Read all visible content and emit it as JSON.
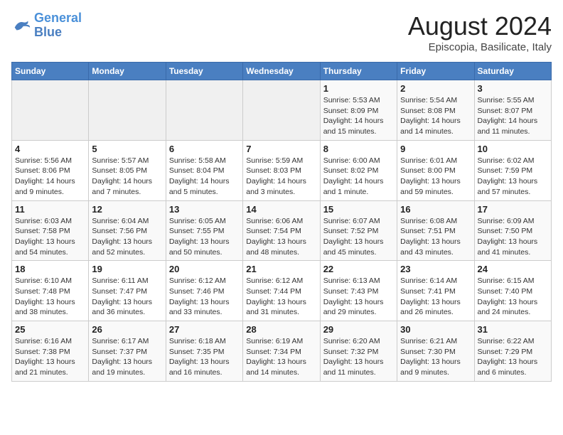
{
  "header": {
    "logo_general": "General",
    "logo_blue": "Blue",
    "month_title": "August 2024",
    "location": "Episcopia, Basilicate, Italy"
  },
  "days_of_week": [
    "Sunday",
    "Monday",
    "Tuesday",
    "Wednesday",
    "Thursday",
    "Friday",
    "Saturday"
  ],
  "weeks": [
    [
      {
        "num": "",
        "info": ""
      },
      {
        "num": "",
        "info": ""
      },
      {
        "num": "",
        "info": ""
      },
      {
        "num": "",
        "info": ""
      },
      {
        "num": "1",
        "info": "Sunrise: 5:53 AM\nSunset: 8:09 PM\nDaylight: 14 hours\nand 15 minutes."
      },
      {
        "num": "2",
        "info": "Sunrise: 5:54 AM\nSunset: 8:08 PM\nDaylight: 14 hours\nand 14 minutes."
      },
      {
        "num": "3",
        "info": "Sunrise: 5:55 AM\nSunset: 8:07 PM\nDaylight: 14 hours\nand 11 minutes."
      }
    ],
    [
      {
        "num": "4",
        "info": "Sunrise: 5:56 AM\nSunset: 8:06 PM\nDaylight: 14 hours\nand 9 minutes."
      },
      {
        "num": "5",
        "info": "Sunrise: 5:57 AM\nSunset: 8:05 PM\nDaylight: 14 hours\nand 7 minutes."
      },
      {
        "num": "6",
        "info": "Sunrise: 5:58 AM\nSunset: 8:04 PM\nDaylight: 14 hours\nand 5 minutes."
      },
      {
        "num": "7",
        "info": "Sunrise: 5:59 AM\nSunset: 8:03 PM\nDaylight: 14 hours\nand 3 minutes."
      },
      {
        "num": "8",
        "info": "Sunrise: 6:00 AM\nSunset: 8:02 PM\nDaylight: 14 hours\nand 1 minute."
      },
      {
        "num": "9",
        "info": "Sunrise: 6:01 AM\nSunset: 8:00 PM\nDaylight: 13 hours\nand 59 minutes."
      },
      {
        "num": "10",
        "info": "Sunrise: 6:02 AM\nSunset: 7:59 PM\nDaylight: 13 hours\nand 57 minutes."
      }
    ],
    [
      {
        "num": "11",
        "info": "Sunrise: 6:03 AM\nSunset: 7:58 PM\nDaylight: 13 hours\nand 54 minutes."
      },
      {
        "num": "12",
        "info": "Sunrise: 6:04 AM\nSunset: 7:56 PM\nDaylight: 13 hours\nand 52 minutes."
      },
      {
        "num": "13",
        "info": "Sunrise: 6:05 AM\nSunset: 7:55 PM\nDaylight: 13 hours\nand 50 minutes."
      },
      {
        "num": "14",
        "info": "Sunrise: 6:06 AM\nSunset: 7:54 PM\nDaylight: 13 hours\nand 48 minutes."
      },
      {
        "num": "15",
        "info": "Sunrise: 6:07 AM\nSunset: 7:52 PM\nDaylight: 13 hours\nand 45 minutes."
      },
      {
        "num": "16",
        "info": "Sunrise: 6:08 AM\nSunset: 7:51 PM\nDaylight: 13 hours\nand 43 minutes."
      },
      {
        "num": "17",
        "info": "Sunrise: 6:09 AM\nSunset: 7:50 PM\nDaylight: 13 hours\nand 41 minutes."
      }
    ],
    [
      {
        "num": "18",
        "info": "Sunrise: 6:10 AM\nSunset: 7:48 PM\nDaylight: 13 hours\nand 38 minutes."
      },
      {
        "num": "19",
        "info": "Sunrise: 6:11 AM\nSunset: 7:47 PM\nDaylight: 13 hours\nand 36 minutes."
      },
      {
        "num": "20",
        "info": "Sunrise: 6:12 AM\nSunset: 7:46 PM\nDaylight: 13 hours\nand 33 minutes."
      },
      {
        "num": "21",
        "info": "Sunrise: 6:12 AM\nSunset: 7:44 PM\nDaylight: 13 hours\nand 31 minutes."
      },
      {
        "num": "22",
        "info": "Sunrise: 6:13 AM\nSunset: 7:43 PM\nDaylight: 13 hours\nand 29 minutes."
      },
      {
        "num": "23",
        "info": "Sunrise: 6:14 AM\nSunset: 7:41 PM\nDaylight: 13 hours\nand 26 minutes."
      },
      {
        "num": "24",
        "info": "Sunrise: 6:15 AM\nSunset: 7:40 PM\nDaylight: 13 hours\nand 24 minutes."
      }
    ],
    [
      {
        "num": "25",
        "info": "Sunrise: 6:16 AM\nSunset: 7:38 PM\nDaylight: 13 hours\nand 21 minutes."
      },
      {
        "num": "26",
        "info": "Sunrise: 6:17 AM\nSunset: 7:37 PM\nDaylight: 13 hours\nand 19 minutes."
      },
      {
        "num": "27",
        "info": "Sunrise: 6:18 AM\nSunset: 7:35 PM\nDaylight: 13 hours\nand 16 minutes."
      },
      {
        "num": "28",
        "info": "Sunrise: 6:19 AM\nSunset: 7:34 PM\nDaylight: 13 hours\nand 14 minutes."
      },
      {
        "num": "29",
        "info": "Sunrise: 6:20 AM\nSunset: 7:32 PM\nDaylight: 13 hours\nand 11 minutes."
      },
      {
        "num": "30",
        "info": "Sunrise: 6:21 AM\nSunset: 7:30 PM\nDaylight: 13 hours\nand 9 minutes."
      },
      {
        "num": "31",
        "info": "Sunrise: 6:22 AM\nSunset: 7:29 PM\nDaylight: 13 hours\nand 6 minutes."
      }
    ]
  ]
}
